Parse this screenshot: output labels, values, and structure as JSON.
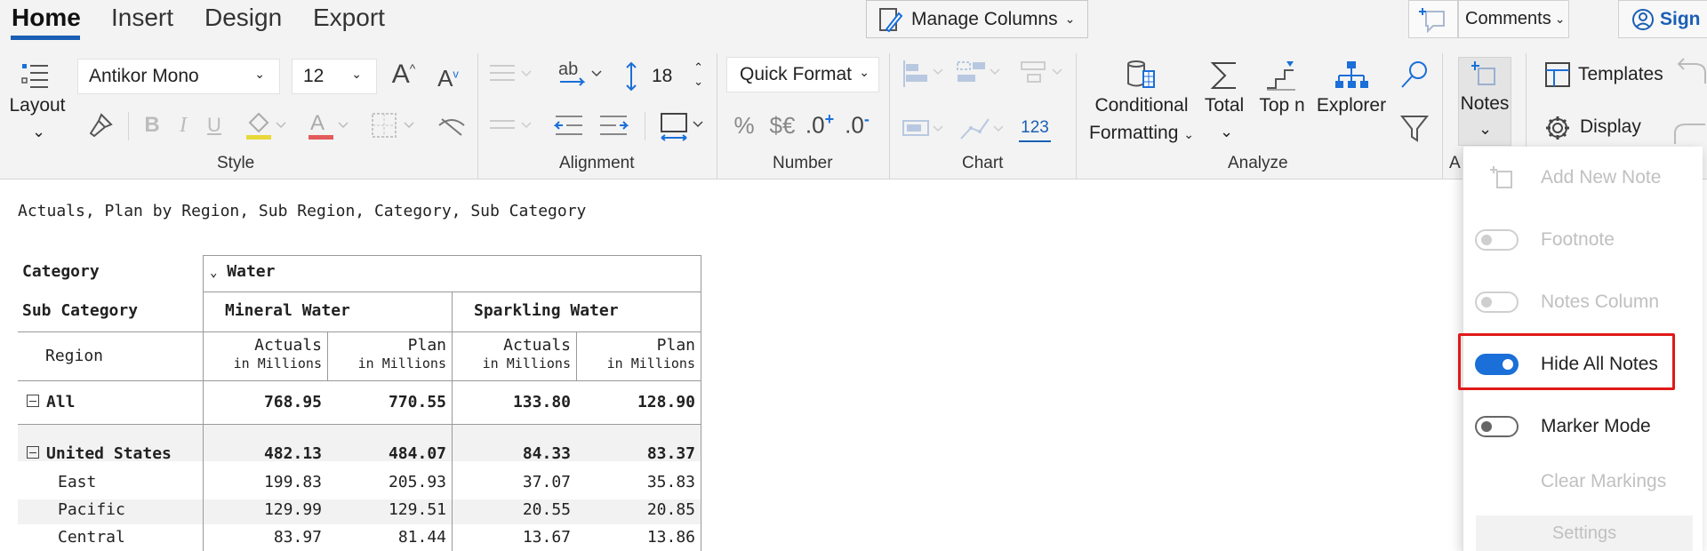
{
  "tabs": [
    {
      "label": "Home"
    },
    {
      "label": "Insert"
    },
    {
      "label": "Design"
    },
    {
      "label": "Export"
    }
  ],
  "topbar": {
    "manage_columns": "Manage Columns",
    "comments": "Comments",
    "sign": "Sign"
  },
  "ribbon": {
    "layout": "Layout",
    "font_name": "Antikor Mono",
    "font_size": "12",
    "line_height": "18",
    "quick_format": "Quick Format",
    "number_tile": "123",
    "conditional": "Conditional",
    "formatting": "Formatting",
    "total": "Total",
    "top_n": "Top n",
    "explorer": "Explorer",
    "notes": "Notes",
    "templates": "Templates",
    "display": "Display",
    "groups": {
      "style": "Style",
      "alignment": "Alignment",
      "number": "Number",
      "chart": "Chart",
      "analyze": "Analyze",
      "cut": "A"
    }
  },
  "report": {
    "subtitle": "Actuals, Plan by Region, Sub Region, Category, Sub Category",
    "category_label": "Category",
    "subcategory_label": "Sub Category",
    "region_label": "Region",
    "category": "Water",
    "subcategories": [
      "Mineral Water",
      "Sparkling Water"
    ],
    "measures": [
      {
        "name": "Actuals",
        "unit": "in Millions"
      },
      {
        "name": "Plan",
        "unit": "in Millions"
      },
      {
        "name": "Actuals",
        "unit": "in Millions"
      },
      {
        "name": "Plan",
        "unit": "in Millions"
      }
    ],
    "rows": [
      {
        "label": "All",
        "values": [
          "768.95",
          "770.55",
          "133.80",
          "128.90"
        ]
      },
      {
        "label": "United States",
        "values": [
          "482.13",
          "484.07",
          "84.33",
          "83.37"
        ]
      },
      {
        "label": "East",
        "values": [
          "199.83",
          "205.93",
          "37.07",
          "35.83"
        ]
      },
      {
        "label": "Pacific",
        "values": [
          "129.99",
          "129.51",
          "20.55",
          "20.85"
        ]
      },
      {
        "label": "Central",
        "values": [
          "83.97",
          "81.44",
          "13.67",
          "13.86"
        ]
      }
    ]
  },
  "notes_menu": {
    "items": [
      {
        "label": "Add New Note",
        "enabled": false
      },
      {
        "label": "Footnote",
        "enabled": false,
        "toggle": "off"
      },
      {
        "label": "Notes Column",
        "enabled": false,
        "toggle": "off"
      },
      {
        "label": "Hide All Notes",
        "enabled": true,
        "toggle": "on"
      },
      {
        "label": "Marker Mode",
        "enabled": true,
        "toggle": "off"
      },
      {
        "label": "Clear Markings",
        "enabled": false
      }
    ],
    "settings": "Settings"
  },
  "colors": {
    "accent": "#1a6fd8",
    "highlight": "#e01919",
    "ribbon_bg": "#f3f3f3"
  }
}
